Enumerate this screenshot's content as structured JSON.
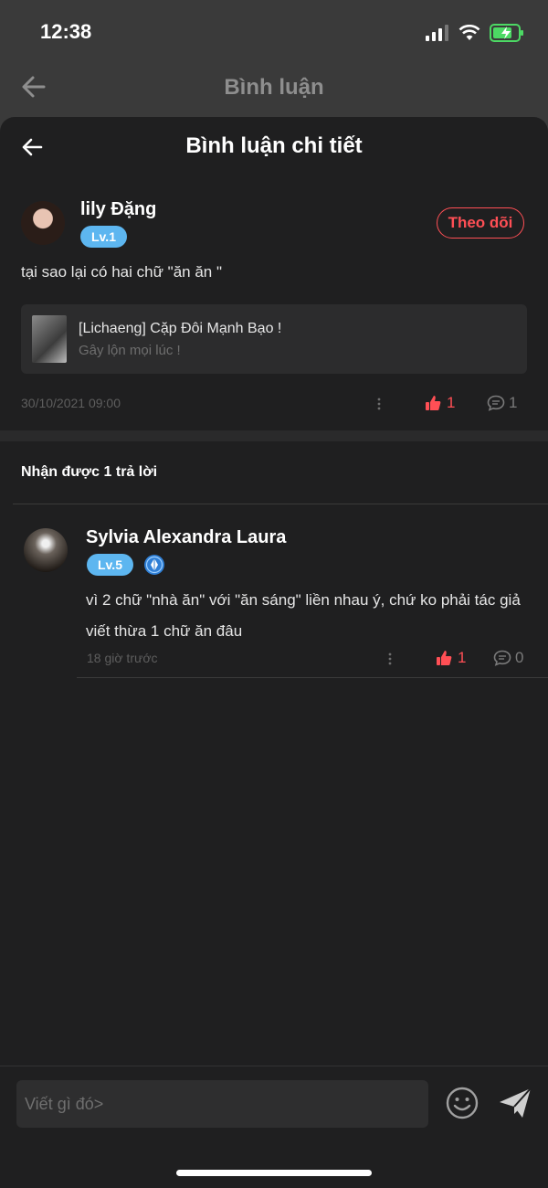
{
  "status_bar": {
    "time": "12:38"
  },
  "background_page": {
    "title": "Bình luận"
  },
  "sheet": {
    "title": "Bình luận chi tiết",
    "comment": {
      "user_name": "lily Đặng",
      "level": "Lv.1",
      "follow_label": "Theo dõi",
      "text": "tại sao lại có hai chữ \"ăn ăn \"",
      "story": {
        "title": "[Lichaeng] Cặp Đôi Mạnh Bạo !",
        "subtitle": "Gây lộn mọi lúc !"
      },
      "timestamp": "30/10/2021 09:00",
      "likes": "1",
      "replies": "1"
    },
    "replies_header": "Nhận được 1 trả lời",
    "reply": {
      "user_name": "Sylvia Alexandra Laura",
      "level": "Lv.5",
      "text": "vì 2 chữ \"nhà ăn\" với \"ăn sáng\" liền nhau ý, chứ ko phải tác giả viết thừa 1 chữ ăn đâu",
      "timestamp": "18 giờ trước",
      "likes": "1",
      "replies": "0"
    },
    "input": {
      "placeholder": "Viết gì đó>"
    }
  },
  "colors": {
    "accent": "#ff4f55",
    "level_badge": "#5db6f0",
    "sheet_bg": "#1f1f20"
  }
}
